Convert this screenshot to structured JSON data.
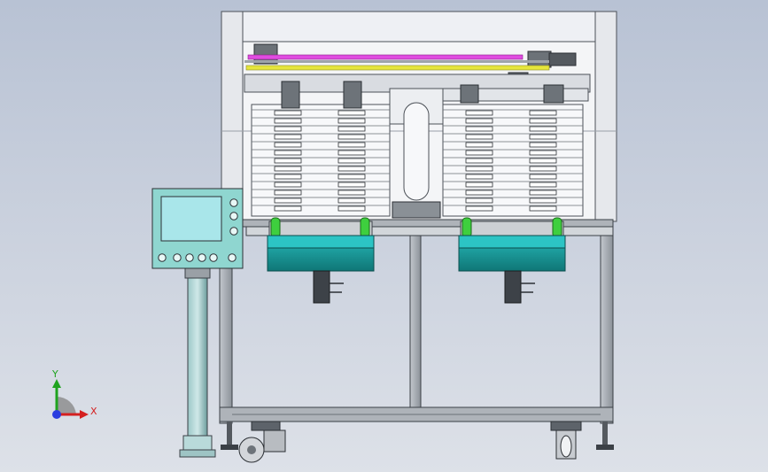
{
  "triad": {
    "y_label": "Y",
    "x_label": "X",
    "colors": {
      "y": "#1fa31f",
      "x": "#d42020",
      "z": "#2a3de0",
      "arc": "#8a8a8a"
    }
  },
  "colors": {
    "frame": "#8f969e",
    "frame_dark": "#4c5158",
    "panel_white": "#f4f5f7",
    "hmi_body": "#8fd6d0",
    "hmi_screen": "#a9e6ea",
    "teal_unit": "#1fa6a6",
    "teal_dark": "#0e6f72",
    "green_roller": "#3ecf3e",
    "magenta_belt": "#e04ce0",
    "yellow_rail": "#e6e63c",
    "column": "#7fb3b3"
  },
  "icons": [
    "axis-triad-icon",
    "caster-wheel-icon",
    "leveling-foot-icon",
    "hmi-button-icon",
    "tray-stack-icon",
    "cylinder-icon"
  ]
}
